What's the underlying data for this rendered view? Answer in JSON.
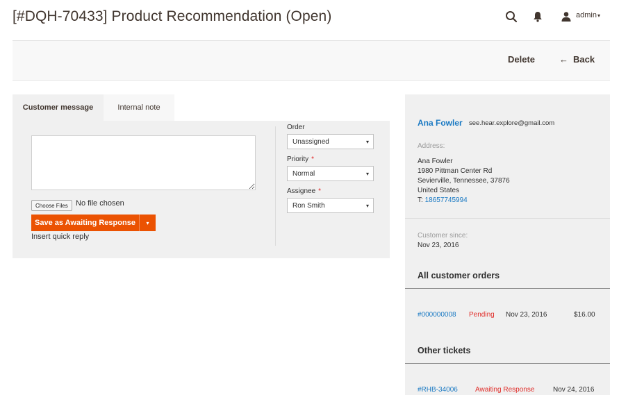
{
  "header": {
    "title": "[#DQH-70433] Product Recommendation (Open)",
    "search_icon": "search-icon",
    "bell_icon": "bell-icon",
    "user_icon": "user-icon",
    "admin_label": "admin",
    "admin_caret": "▾"
  },
  "actions": {
    "delete_label": "Delete",
    "back_label": "Back",
    "back_arrow": "←"
  },
  "tabs": [
    {
      "label": "Customer message",
      "active": true
    },
    {
      "label": "Internal note",
      "active": false
    }
  ],
  "reply": {
    "message_value": "",
    "choose_files_label": "Choose Files",
    "no_file_text": "No file chosen",
    "save_label": "Save as Awaiting Response",
    "save_caret": "▾",
    "quick_reply_label": "Insert quick reply"
  },
  "fields": {
    "order_label": "Order",
    "order_value": "Unassigned",
    "priority_label": "Priority",
    "priority_value": "Normal",
    "assignee_label": "Assignee",
    "assignee_value": "Ron Smith",
    "required_mark": "*",
    "caret": "▾"
  },
  "customer": {
    "name": "Ana Fowler",
    "email": "see.hear.explore@gmail.com",
    "address_label": "Address:",
    "address_lines": [
      "Ana Fowler",
      "1980 Pittman Center Rd",
      "Sevierville, Tennessee, 37876",
      "United States"
    ],
    "phone_prefix": "T:",
    "phone": "18657745994",
    "since_label": "Customer since:",
    "since_value": "Nov 23, 2016"
  },
  "orders": {
    "title": "All customer orders",
    "rows": [
      {
        "id": "#000000008",
        "status": "Pending",
        "date": "Nov 23, 2016",
        "total": "$16.00"
      }
    ]
  },
  "tickets": {
    "title": "Other tickets",
    "rows": [
      {
        "id": "#RHB-34006",
        "status": "Awaiting Response",
        "date": "Nov 24, 2016"
      }
    ]
  },
  "colors": {
    "accent": "#eb5202",
    "link": "#1979c3",
    "status_red": "#e02b27"
  }
}
